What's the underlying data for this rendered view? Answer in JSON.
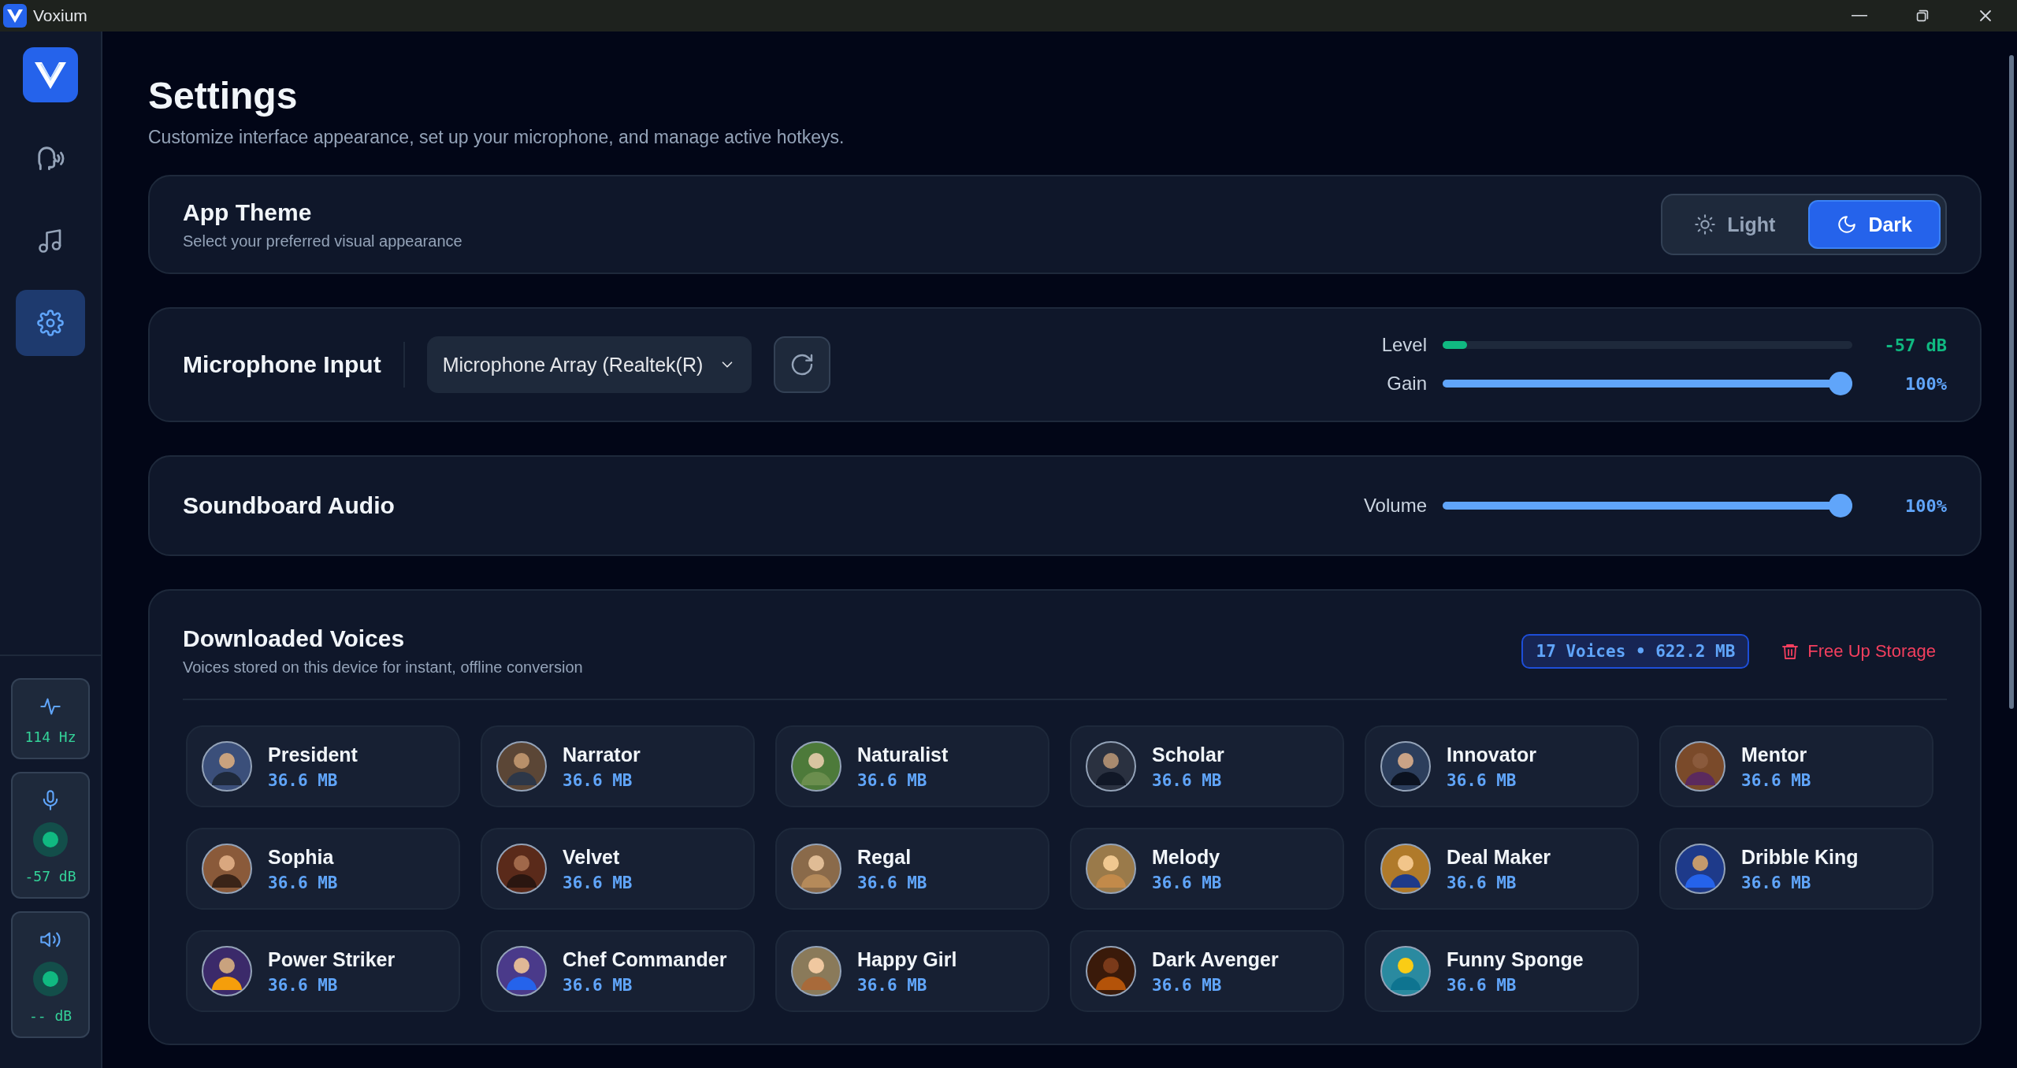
{
  "window": {
    "title": "Voxium"
  },
  "sidebar": {
    "nav": [
      {
        "kind": "voice",
        "selected": false
      },
      {
        "kind": "music",
        "selected": false
      },
      {
        "kind": "settings",
        "selected": true
      }
    ],
    "monitors": [
      {
        "kind": "pitch",
        "reading": "114 Hz"
      },
      {
        "kind": "mic",
        "reading": "-57 dB"
      },
      {
        "kind": "speaker",
        "reading": "-- dB"
      }
    ]
  },
  "page": {
    "title": "Settings",
    "subtitle": "Customize interface appearance, set up your microphone, and manage active hotkeys."
  },
  "theme": {
    "title": "App Theme",
    "subtitle": "Select your preferred visual appearance",
    "options": [
      {
        "kind": "light",
        "label": "Light",
        "selected": false
      },
      {
        "kind": "dark",
        "label": "Dark",
        "selected": true
      }
    ]
  },
  "microphone": {
    "title": "Microphone Input",
    "device": "Microphone Array (Realtek(R)",
    "meters": [
      {
        "kind": "meter",
        "label": "Level",
        "level": 0.06,
        "reading": "-57 dB"
      },
      {
        "kind": "slider",
        "label": "Gain",
        "level": 1,
        "reading": "100%"
      }
    ]
  },
  "soundboard": {
    "title": "Soundboard Audio",
    "meters": [
      {
        "kind": "slider",
        "label": "Volume",
        "level": 1,
        "reading": "100%"
      }
    ]
  },
  "voices": {
    "title": "Downloaded Voices",
    "subtitle": "Voices stored on this device for instant, offline conversion",
    "summary": "17 Voices • 622.2 MB",
    "action": "Free Up Storage",
    "items": [
      {
        "name": "President",
        "size": "36.6 MB"
      },
      {
        "name": "Narrator",
        "size": "36.6 MB"
      },
      {
        "name": "Naturalist",
        "size": "36.6 MB"
      },
      {
        "name": "Scholar",
        "size": "36.6 MB"
      },
      {
        "name": "Innovator",
        "size": "36.6 MB"
      },
      {
        "name": "Mentor",
        "size": "36.6 MB"
      },
      {
        "name": "Sophia",
        "size": "36.6 MB"
      },
      {
        "name": "Velvet",
        "size": "36.6 MB"
      },
      {
        "name": "Regal",
        "size": "36.6 MB"
      },
      {
        "name": "Melody",
        "size": "36.6 MB"
      },
      {
        "name": "Deal Maker",
        "size": "36.6 MB"
      },
      {
        "name": "Dribble King",
        "size": "36.6 MB"
      },
      {
        "name": "Power Striker",
        "size": "36.6 MB"
      },
      {
        "name": "Chef Commander",
        "size": "36.6 MB"
      },
      {
        "name": "Happy Girl",
        "size": "36.6 MB"
      },
      {
        "name": "Dark Avenger",
        "size": "36.6 MB"
      },
      {
        "name": "Funny Sponge",
        "size": "36.6 MB"
      }
    ]
  }
}
